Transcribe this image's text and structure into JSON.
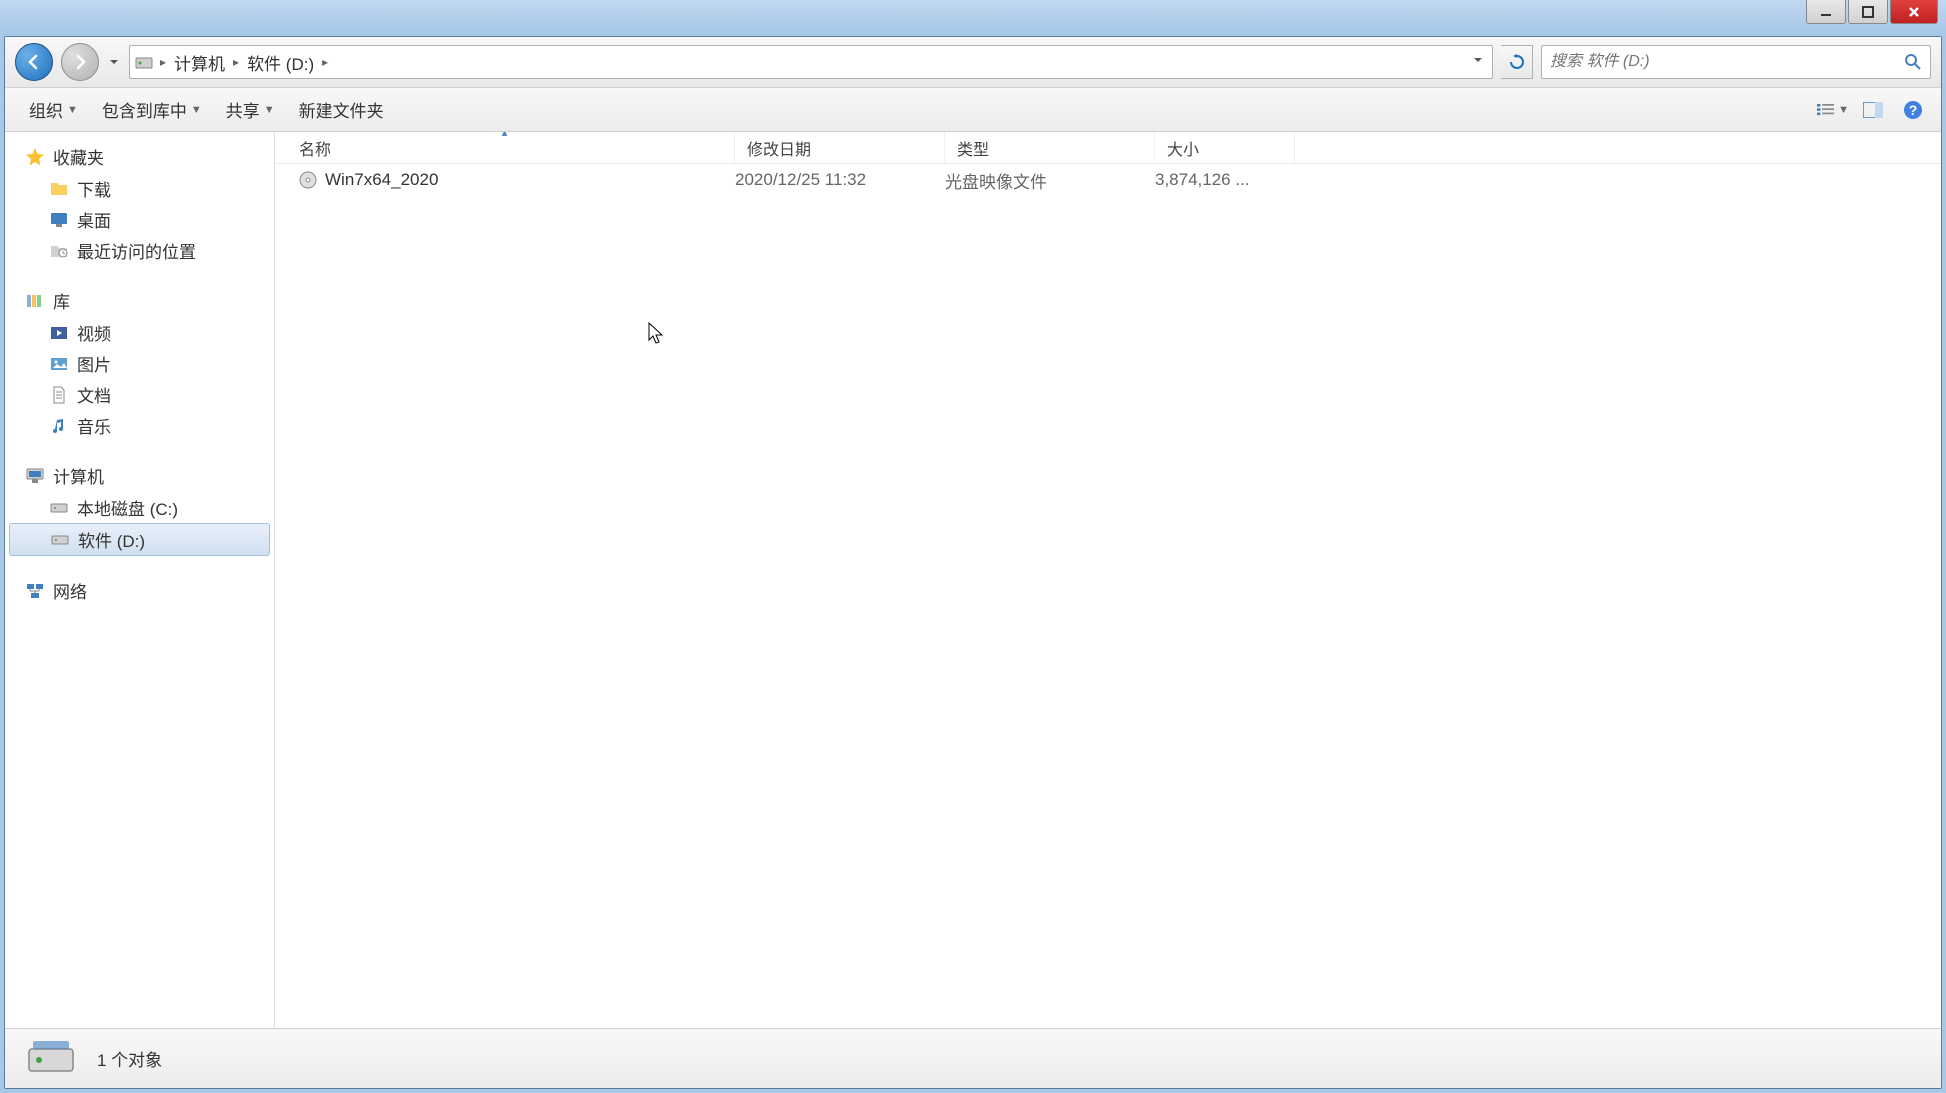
{
  "breadcrumbs": [
    "计算机",
    "软件 (D:)"
  ],
  "search": {
    "placeholder": "搜索 软件 (D:)"
  },
  "toolbar": {
    "organize": "组织",
    "include": "包含到库中",
    "share": "共享",
    "newfolder": "新建文件夹"
  },
  "columns": {
    "name": "名称",
    "date": "修改日期",
    "type": "类型",
    "size": "大小"
  },
  "sidebar": {
    "favorites": {
      "label": "收藏夹",
      "items": [
        "下载",
        "桌面",
        "最近访问的位置"
      ]
    },
    "libraries": {
      "label": "库",
      "items": [
        "视频",
        "图片",
        "文档",
        "音乐"
      ]
    },
    "computer": {
      "label": "计算机",
      "items": [
        "本地磁盘 (C:)",
        "软件 (D:)"
      ]
    },
    "network": {
      "label": "网络"
    }
  },
  "files": [
    {
      "name": "Win7x64_2020",
      "date": "2020/12/25 11:32",
      "type": "光盘映像文件",
      "size": "3,874,126 ..."
    }
  ],
  "status": {
    "text": "1 个对象"
  }
}
